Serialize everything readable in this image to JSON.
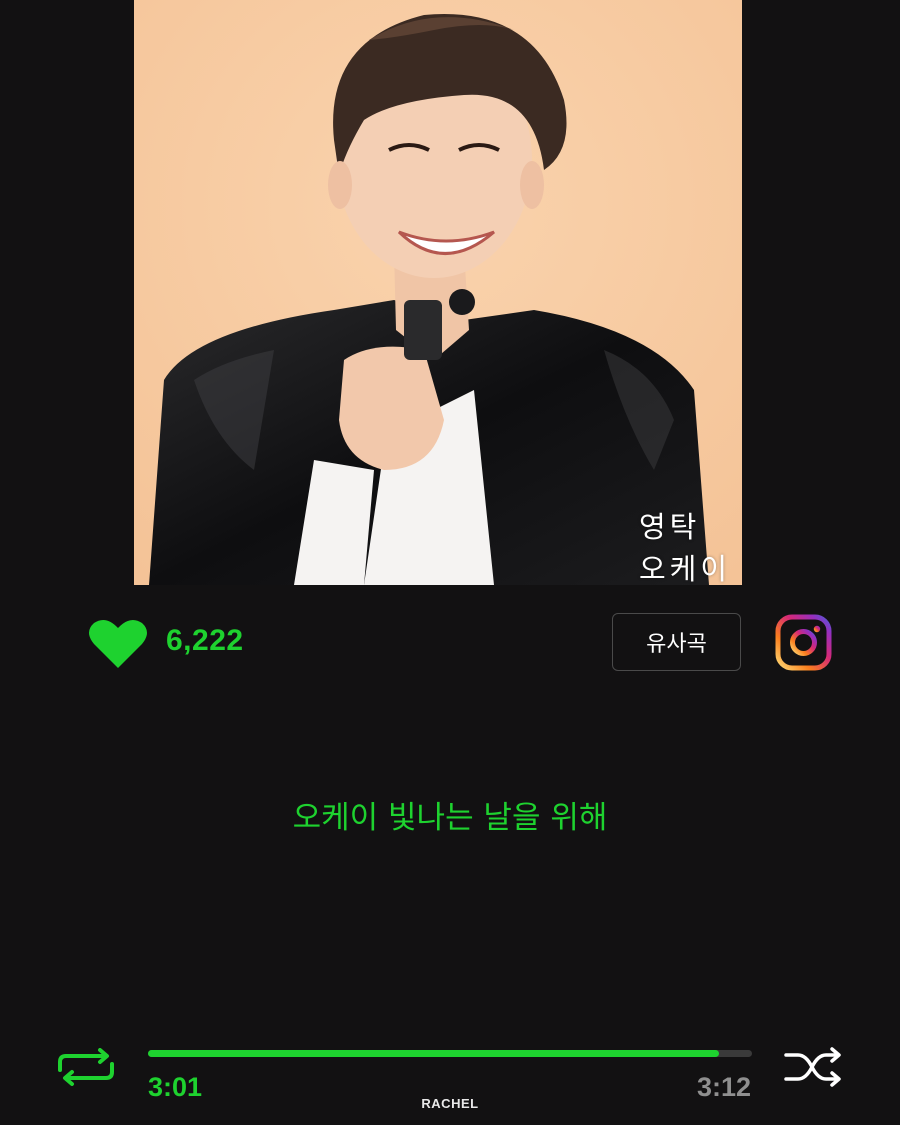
{
  "album": {
    "caption": "영탁 오케이"
  },
  "actions": {
    "like_count": "6,222",
    "similar_label": "유사곡",
    "like_icon": "heart-icon",
    "instagram_icon": "instagram-icon"
  },
  "lyrics": {
    "current_line": "오케이 빛나는 날을 위해"
  },
  "player": {
    "elapsed": "3:01",
    "total": "3:12",
    "progress": 0.945,
    "repeat_icon": "repeat-icon",
    "shuffle_icon": "shuffle-icon"
  },
  "watermark": "RACHEL",
  "colors": {
    "accent": "#1ed22f",
    "background": "#121112",
    "album_background": "#f7c9a0"
  }
}
